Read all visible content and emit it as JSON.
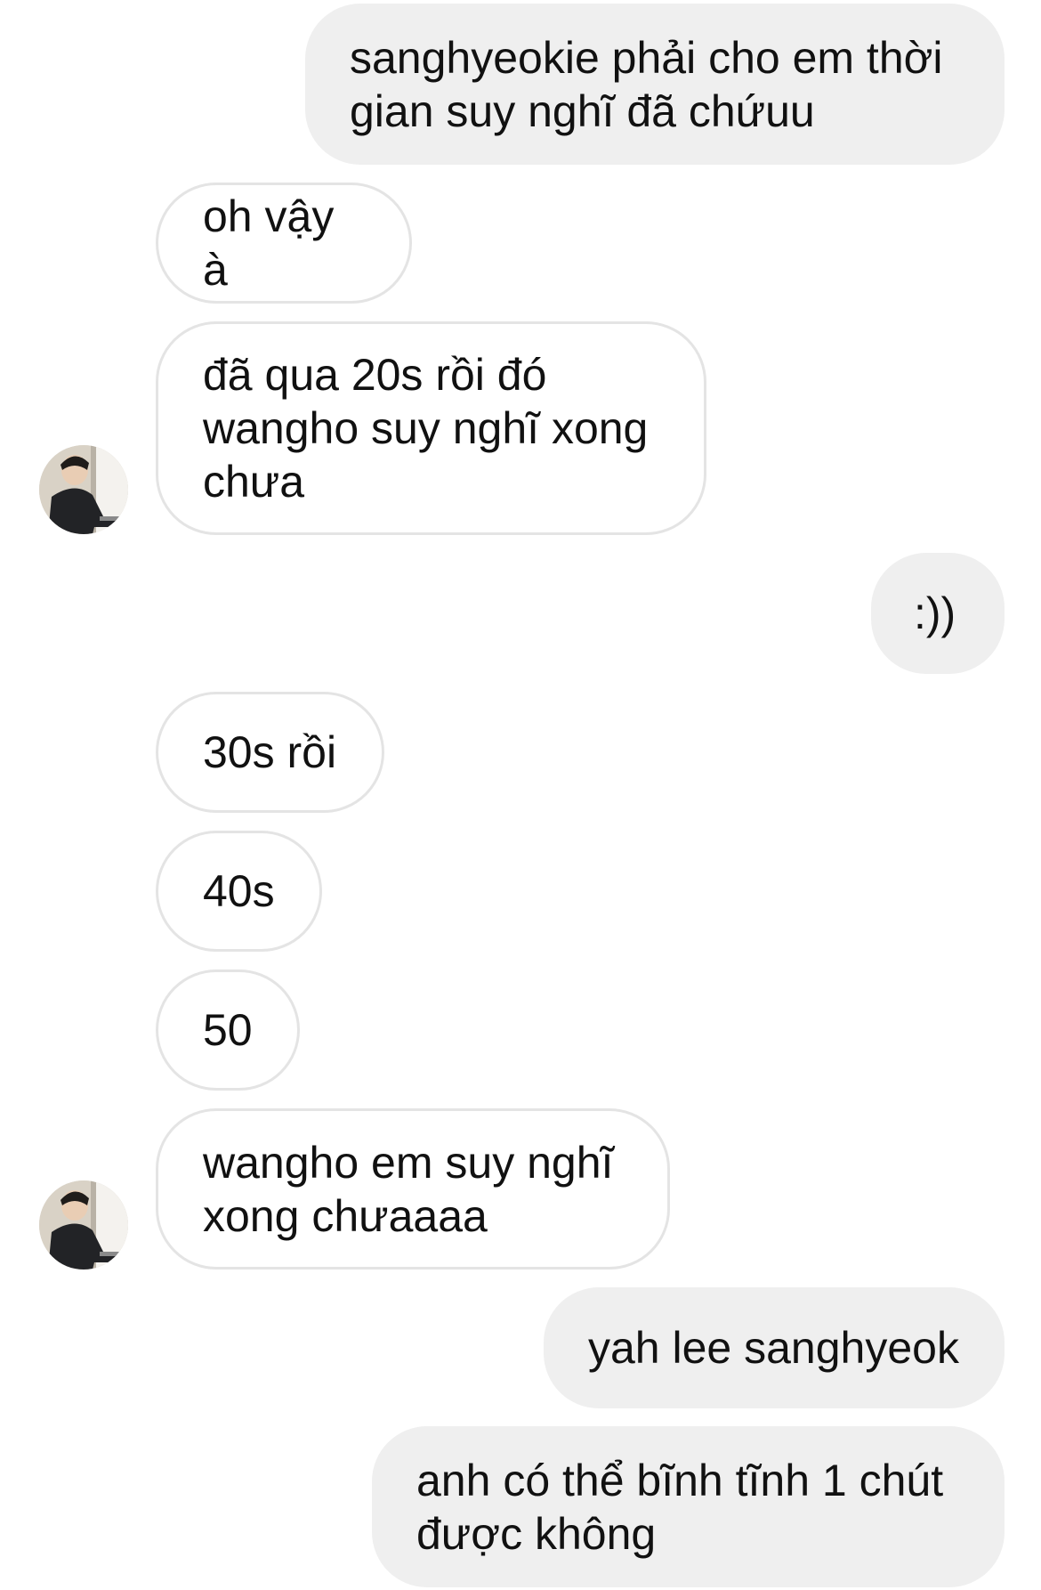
{
  "messages": [
    {
      "side": "sent",
      "text": "sanghyeokie phải cho em thời gian suy nghĩ đã chứuu"
    },
    {
      "side": "received",
      "text": "oh vậy à"
    },
    {
      "side": "received",
      "text": "đã qua 20s rồi đó wangho suy nghĩ xong chưa"
    },
    {
      "side": "sent",
      "text": ":))"
    },
    {
      "side": "received",
      "text": "30s rồi"
    },
    {
      "side": "received",
      "text": "40s"
    },
    {
      "side": "received",
      "text": "50"
    },
    {
      "side": "received",
      "text": "wangho em suy nghĩ xong chưaaaa"
    },
    {
      "side": "sent",
      "text": "yah lee sanghyeok"
    },
    {
      "side": "sent",
      "text": "anh có thể bĩnh tĩnh 1 chút được không"
    }
  ],
  "colors": {
    "sent_bubble": "#efefef",
    "received_bubble": "#ffffff",
    "received_border": "#e4e4e4",
    "text": "#111111"
  },
  "icons": {
    "avatar": "contact-avatar-photo"
  }
}
